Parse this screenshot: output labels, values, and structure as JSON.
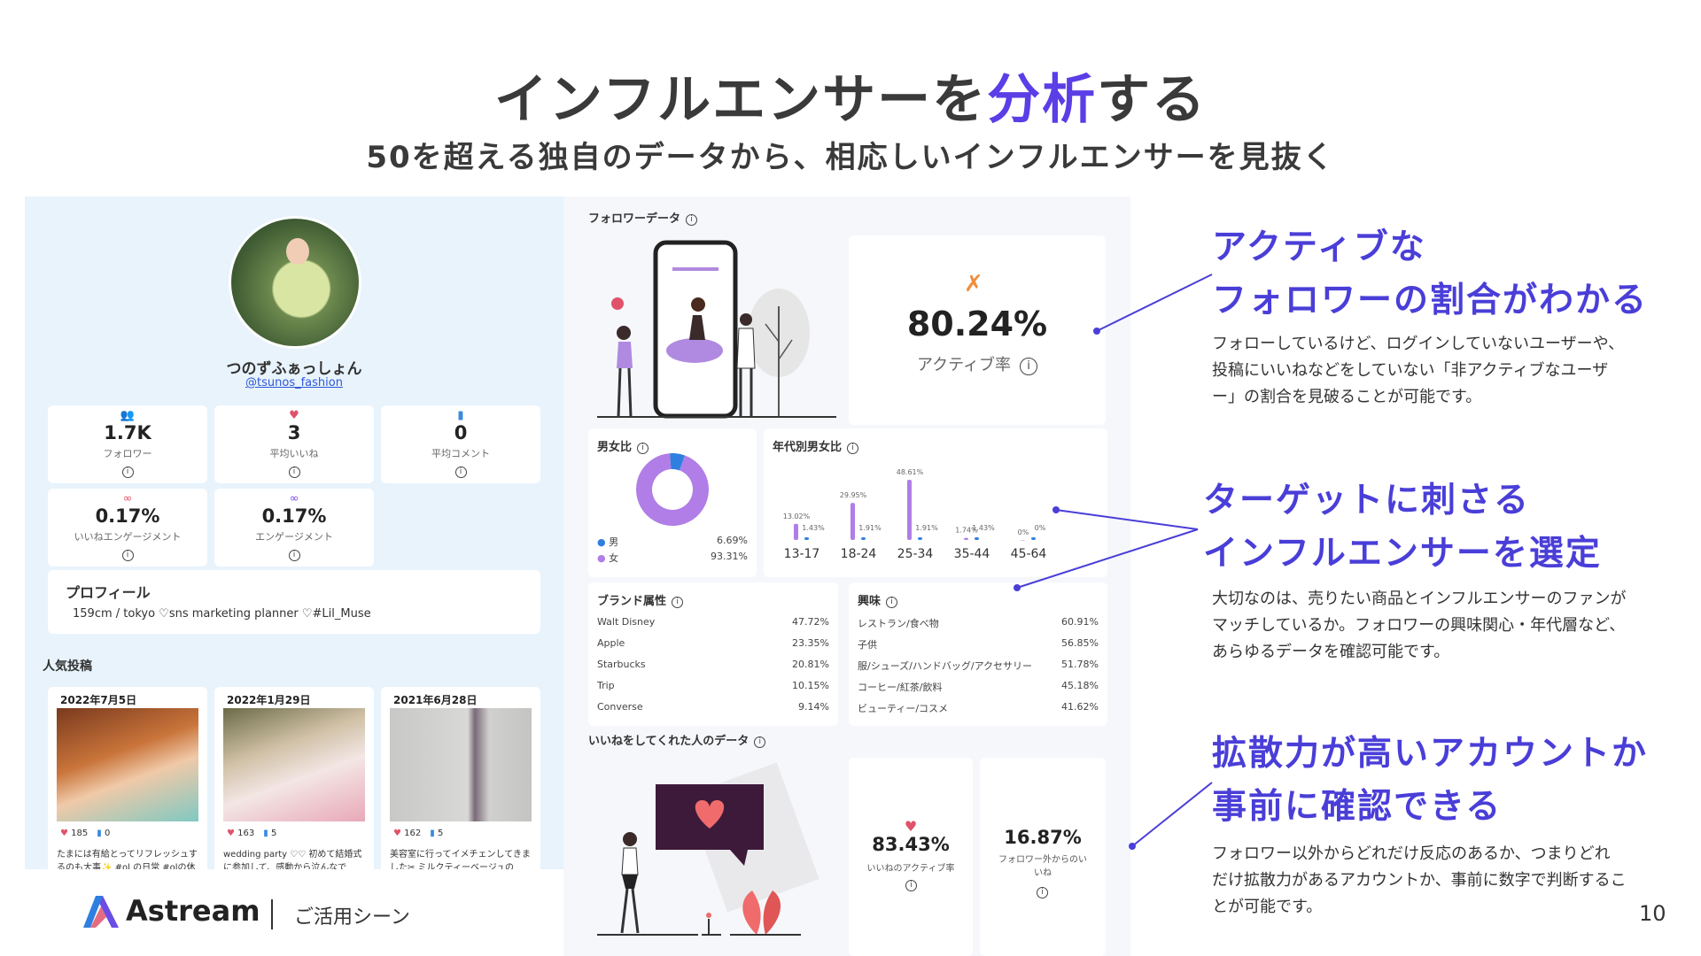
{
  "title": {
    "before": "インフルエンサーを",
    "accent": "分析",
    "after": "する"
  },
  "subtitle": "50を超える独自のデータから、相応しいインフルエンサーを見抜く",
  "profile": {
    "name": "つのずふぁっしょん",
    "handle": "@tsunos_fashion",
    "stats": [
      {
        "icon": "followers-icon",
        "value": "1.7K",
        "label": "フォロワー"
      },
      {
        "icon": "heart-icon",
        "value": "3",
        "label": "平均いいね"
      },
      {
        "icon": "comment-icon",
        "value": "0",
        "label": "平均コメント"
      },
      {
        "icon": "infinity-icon",
        "value": "0.17%",
        "label": "いいねエンゲージメント"
      },
      {
        "icon": "infinity-icon",
        "value": "0.17%",
        "label": "エンゲージメント"
      }
    ],
    "profile_heading": "プロフィール",
    "profile_text": "159cm / tokyo ♡sns marketing planner ♡#Lil_Muse",
    "popular_heading": "人気投稿",
    "posts": [
      {
        "date": "2022年7月5日",
        "likes": "185",
        "comments": "0",
        "caption": "たまには有給とってリフレッシュするのも大事✨ #ol の日常 #olの休"
      },
      {
        "date": "2022年1月29日",
        "likes": "163",
        "comments": "5",
        "caption": "wedding party ♡♡ 初めて結婚式に参加して、感動から泣んなで"
      },
      {
        "date": "2021年6月28日",
        "likes": "162",
        "comments": "5",
        "caption": "美容室に行ってイメチェンしてきました✂ ミルクティーベージュの"
      }
    ]
  },
  "follower_data": {
    "heading": "フォロワーデータ",
    "active_rate": "80.24%",
    "active_label": "アクティブ率",
    "gender": {
      "heading": "男女比",
      "male_label": "男",
      "male_value": "6.69%",
      "female_label": "女",
      "female_value": "93.31%",
      "male_share": 6.69,
      "female_share": 93.31,
      "colors": {
        "male": "#2f7fe0",
        "female": "#b07ee6"
      }
    },
    "age": {
      "heading": "年代別男女比",
      "groups": [
        {
          "label": "13-17",
          "female": "13.02%",
          "male": "1.43%",
          "female_v": 13.02,
          "male_v": 1.43
        },
        {
          "label": "18-24",
          "female": "29.95%",
          "male": "1.91%",
          "female_v": 29.95,
          "male_v": 1.91
        },
        {
          "label": "25-34",
          "female": "48.61%",
          "male": "1.91%",
          "female_v": 48.61,
          "male_v": 1.91
        },
        {
          "label": "35-44",
          "female": "1.74%",
          "male": "1.43%",
          "female_v": 1.74,
          "male_v": 1.43
        },
        {
          "label": "45-64",
          "female": "0%",
          "male": "0%",
          "female_v": 0,
          "male_v": 0
        }
      ]
    },
    "brand": {
      "heading": "ブランド属性",
      "rows": [
        {
          "name": "Walt Disney",
          "value": "47.72%"
        },
        {
          "name": "Apple",
          "value": "23.35%"
        },
        {
          "name": "Starbucks",
          "value": "20.81%"
        },
        {
          "name": "Trip",
          "value": "10.15%"
        },
        {
          "name": "Converse",
          "value": "9.14%"
        }
      ]
    },
    "interest": {
      "heading": "興味",
      "rows": [
        {
          "name": "レストラン/食べ物",
          "value": "60.91%"
        },
        {
          "name": "子供",
          "value": "56.85%"
        },
        {
          "name": "服/シューズ/ハンドバッグ/アクセサリー",
          "value": "51.78%"
        },
        {
          "name": "コーヒー/紅茶/飲料",
          "value": "45.18%"
        },
        {
          "name": "ビューティー/コスメ",
          "value": "41.62%"
        }
      ]
    }
  },
  "like_data": {
    "heading": "いいねをしてくれた人のデータ",
    "like_active_value": "83.43%",
    "like_active_label": "いいねのアクティブ率",
    "non_follower_value": "16.87%",
    "non_follower_label": "フォロワー外からのいいね"
  },
  "right": {
    "b1_heading_1": "アクティブな",
    "b1_heading_2": "フォロワーの割合がわかる",
    "b1_text_1": "フォローしているけど、ログインしていないユーザーや、",
    "b1_text_2": "投稿にいいねなどをしていない「非アクティブなユーザ",
    "b1_text_3": "ー」の割合を見破ることが可能です。",
    "b2_heading_1": "ターゲットに刺さる",
    "b2_heading_2": "インフルエンサーを選定",
    "b2_text_1": "大切なのは、売りたい商品とインフルエンサーのファンが",
    "b2_text_2": "マッチしているか。フォロワーの興味関心・年代層など、",
    "b2_text_3": "あらゆるデータを確認可能です。",
    "b3_heading_1": "拡散力が高いアカウントか",
    "b3_heading_2": "事前に確認できる",
    "b3_text_1": "フォロワー以外からどれだけ反応のあるか、つまりどれ",
    "b3_text_2": "だけ拡散力があるアカウントか、事前に数字で判断するこ",
    "b3_text_3": "とが可能です。"
  },
  "footer": {
    "logo": "Astream",
    "scene": "ご活用シーン",
    "page": "10"
  },
  "colors": {
    "accent": "#5b3ee6",
    "heading_purple": "#4a3ed8",
    "panel_bg": "#e8f3fc"
  }
}
